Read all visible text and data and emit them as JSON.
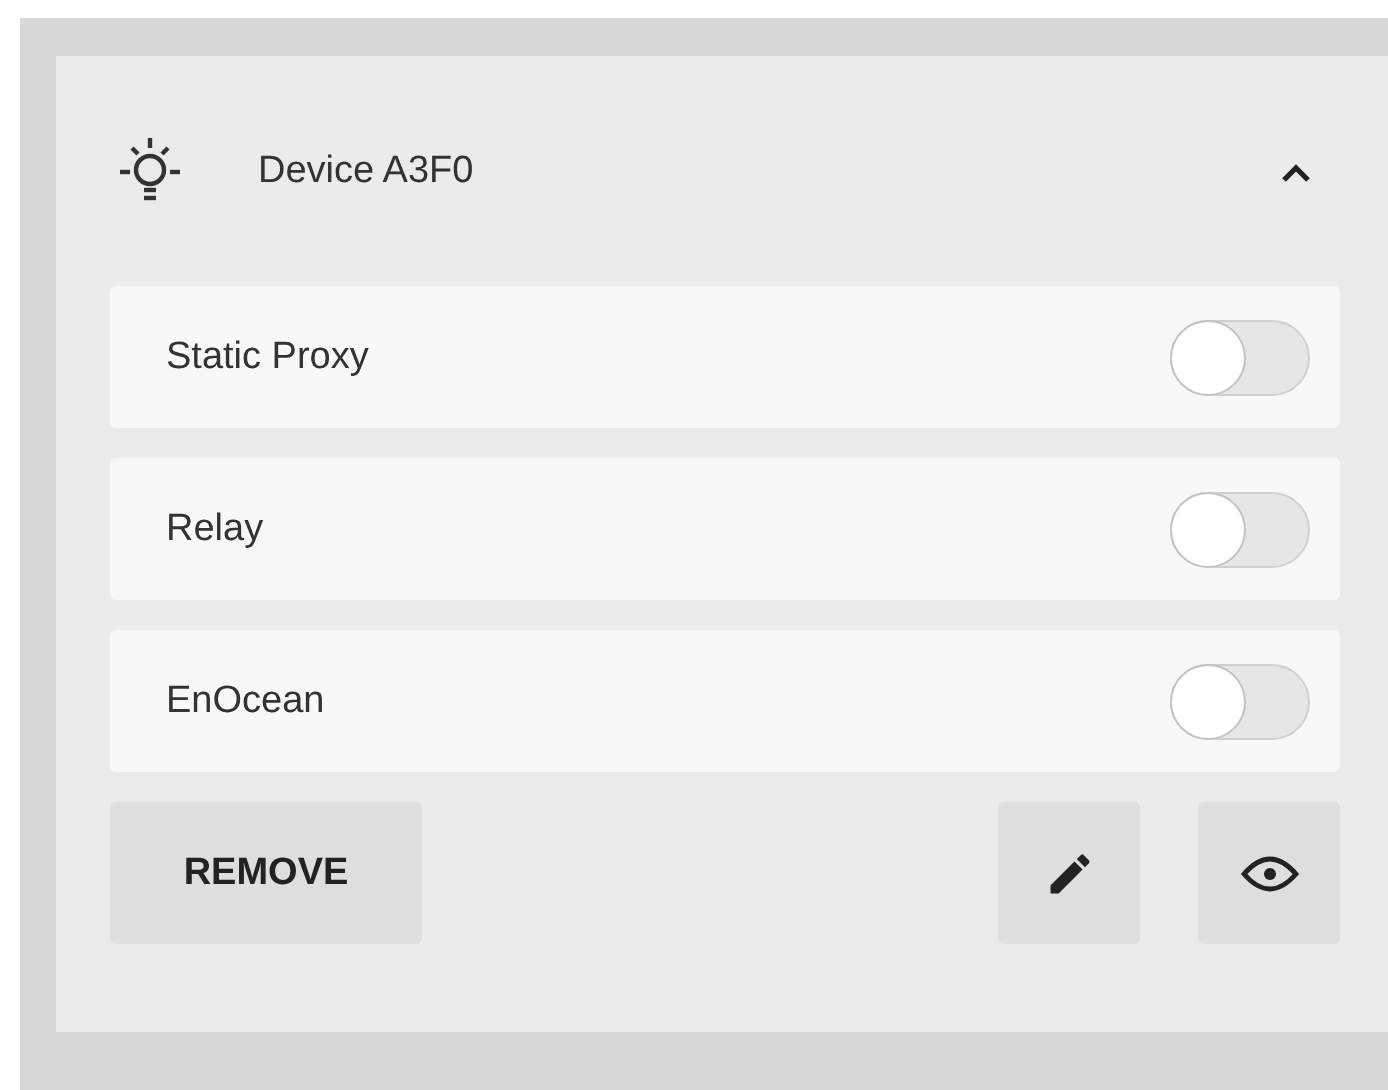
{
  "device": {
    "title": "Device A3F0",
    "expanded": true
  },
  "settings": [
    {
      "label": "Static Proxy",
      "on": false
    },
    {
      "label": "Relay",
      "on": false
    },
    {
      "label": "EnOcean",
      "on": false
    }
  ],
  "remove_button": "REMOVE"
}
